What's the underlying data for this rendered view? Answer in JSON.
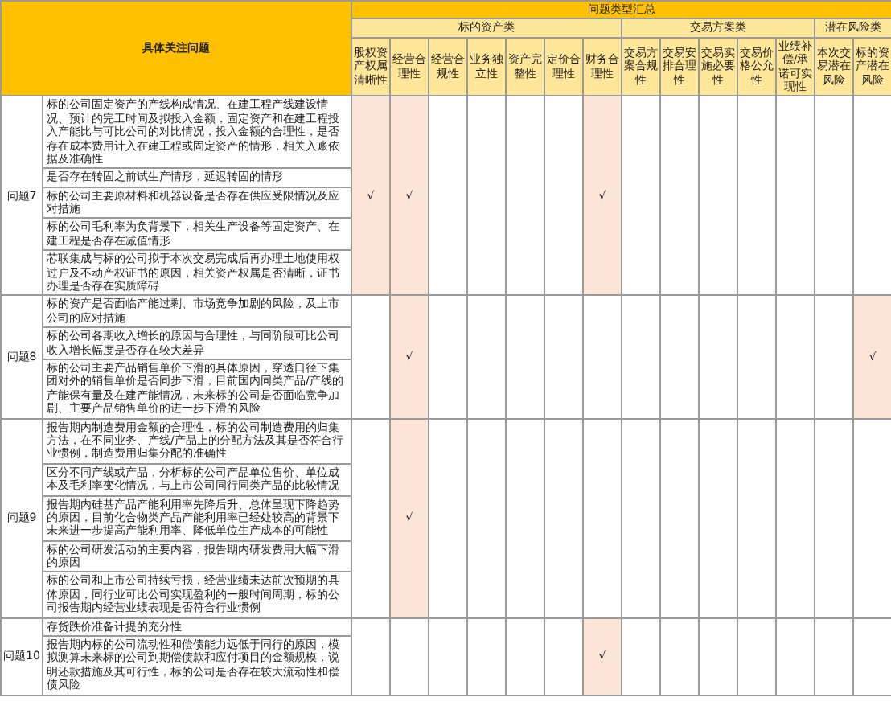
{
  "table": {
    "corner_header": "具体关注问题",
    "group_header": "问题类型汇总",
    "categories": [
      {
        "label": "标的资产类",
        "columns": [
          "股权资产权属清晰性",
          "经营合理性",
          "经营合规性",
          "业务独立性",
          "资产完整性",
          "定价合理性",
          "财务合理性"
        ]
      },
      {
        "label": "交易方案类",
        "columns": [
          "交易方案合规性",
          "交易安排合理性",
          "交易实施必要性",
          "交易价格公允性",
          "业绩补偿/承诺可实现性"
        ]
      },
      {
        "label": "潜在风险类",
        "columns": [
          "本次交易潜在风险",
          "标的资产潜在风险"
        ]
      }
    ],
    "rows": [
      {
        "label": "问题7",
        "items": [
          "标的公司固定资产的产线构成情况、在建工程产线建设情况、预计的完工时间及拟投入金额，固定资产和在建工程投入产能比与可比公司的对比情况，投入金额的合理性，是否存在成本费用计入在建工程或固定资产的情形，相关入账依据及准确性",
          "是否存在转固之前试生产情形，延迟转固的情形",
          "标的公司主要原材料和机器设备是否存在供应受限情况及应对措施",
          "标的公司毛利率为负背景下，相关生产设备等固定资产、在建工程是否存在减值情形",
          "芯联集成与标的公司拟于本次交易完成后再办理土地使用权过户及不动产权证书的原因，相关资产权属是否清晰，证书办理是否存在实质障碍"
        ],
        "cells": [
          {
            "checked": true,
            "text": "√"
          },
          {
            "checked": true,
            "text": "√"
          },
          {
            "checked": false
          },
          {
            "checked": false
          },
          {
            "checked": false
          },
          {
            "checked": false
          },
          {
            "checked": true,
            "text": "√"
          },
          {
            "checked": false
          },
          {
            "checked": false
          },
          {
            "checked": false
          },
          {
            "checked": false
          },
          {
            "checked": false
          },
          {
            "checked": false
          },
          {
            "checked": false
          }
        ]
      },
      {
        "label": "问题8",
        "items": [
          "标的资产是否面临产能过剩、市场竞争加剧的风险，及上市公司的应对措施",
          "标的公司各期收入增长的原因与合理性，与同阶段可比公司收入增长幅度是否存在较大差异",
          "标的公司主要产品销售单价下滑的具体原因，穿透口径下集团对外的销售单价是否同步下滑，目前国内同类产品/产线的产能保有量及在建产能情况，未来标的公司是否面临竞争加剧、主要产品销售单价的进一步下滑的风险"
        ],
        "cells": [
          {
            "checked": false
          },
          {
            "checked": true,
            "text": "√"
          },
          {
            "checked": false
          },
          {
            "checked": false
          },
          {
            "checked": false
          },
          {
            "checked": false
          },
          {
            "checked": false
          },
          {
            "checked": false
          },
          {
            "checked": false
          },
          {
            "checked": false
          },
          {
            "checked": false
          },
          {
            "checked": false
          },
          {
            "checked": false
          },
          {
            "checked": true,
            "text": "√"
          }
        ]
      },
      {
        "label": "问题9",
        "items": [
          "报告期内制造费用金额的合理性，标的公司制造费用的归集方法，在不同业务、产线/产品上的分配方法及其是否符合行业惯例，制造费用归集分配的准确性",
          "区分不同产线或产品，分析标的公司产品单位售价、单位成本及毛利率变化情况，与上市公司同行同类产品的比较情况",
          "报告期内硅基产品产能利用率先降后升、总体呈现下降趋势的原因，目前化合物类产品产能利用率已经处较高的背景下未来进一步提高产能利用率、降低单位生产成本的可能性",
          "标的公司研发活动的主要内容，报告期内研发费用大幅下滑的原因",
          "标的公司和上市公司持续亏损，经营业绩未达前次预期的具体原因，同行业可比公司实现盈利的一般时间周期，标的公司报告期内经营业绩表现是否符合行业惯例"
        ],
        "cells": [
          {
            "checked": false
          },
          {
            "checked": true,
            "text": "√"
          },
          {
            "checked": false
          },
          {
            "checked": false
          },
          {
            "checked": false
          },
          {
            "checked": false
          },
          {
            "checked": false
          },
          {
            "checked": false
          },
          {
            "checked": false
          },
          {
            "checked": false
          },
          {
            "checked": false
          },
          {
            "checked": false
          },
          {
            "checked": false
          },
          {
            "checked": false
          }
        ]
      },
      {
        "label": "问题10",
        "items": [
          "存货跌价准备计提的充分性",
          "报告期内标的公司流动性和偿债能力远低于同行的原因，模拟测算未来标的公司到期偿债款和应付项目的金额规模，说明还款措施及其可行性，标的公司是否存在较大流动性和偿债风险"
        ],
        "cells": [
          {
            "checked": false
          },
          {
            "checked": false
          },
          {
            "checked": false
          },
          {
            "checked": false
          },
          {
            "checked": false
          },
          {
            "checked": false
          },
          {
            "checked": true,
            "text": "√"
          },
          {
            "checked": false
          },
          {
            "checked": false
          },
          {
            "checked": false
          },
          {
            "checked": false
          },
          {
            "checked": false
          },
          {
            "checked": false
          },
          {
            "checked": false
          }
        ]
      }
    ]
  }
}
